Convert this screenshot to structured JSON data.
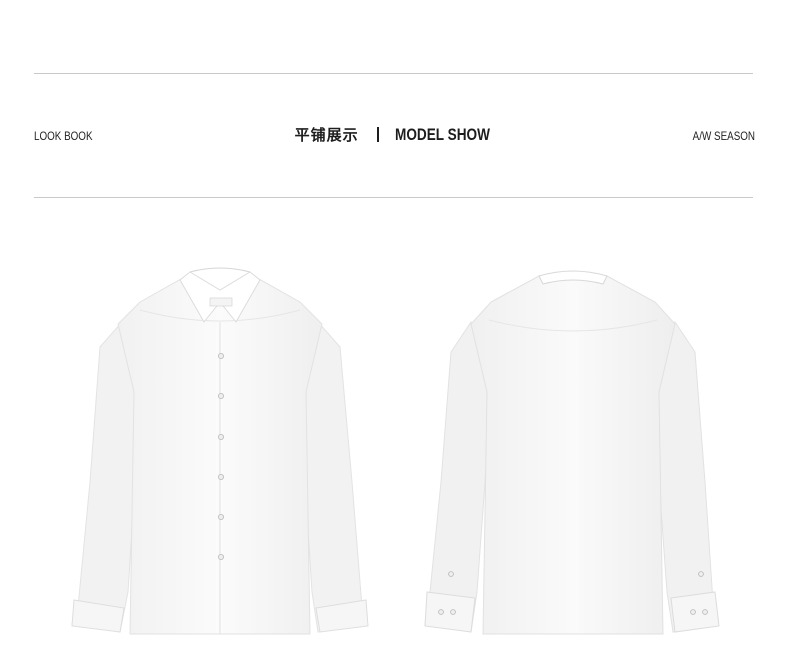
{
  "header": {
    "left_label": "LOOK BOOK",
    "title_cn": "平铺展示",
    "title_en": "MODEL SHOW",
    "right_label": "A/W SEASON"
  },
  "images": {
    "front": {
      "name": "white-shirt-front",
      "color": "#ffffff"
    },
    "back": {
      "name": "white-shirt-back",
      "color": "#ffffff"
    }
  },
  "colors": {
    "rule": "#c9c9c9",
    "text": "#222222",
    "shirt_shadow": "#e6e6e6"
  }
}
